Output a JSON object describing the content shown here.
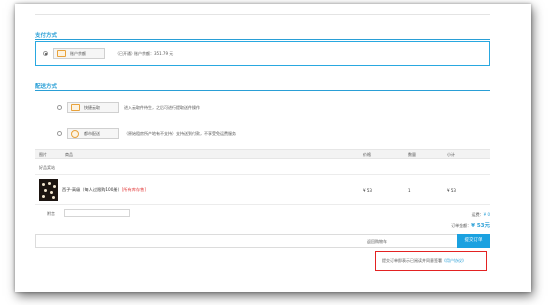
{
  "payment": {
    "title": "支付方式",
    "option_label": "账户余额",
    "status_text": "（已开通）",
    "balance_text": "账户余额：351.79 元"
  },
  "delivery": {
    "title": "配送方式",
    "options": [
      {
        "label": "快捷云取",
        "desc": "进入云取件待生，之后可进行提取送件操作"
      },
      {
        "label": "都市配送",
        "desc": "（原始租房所产地有不支持）支持送到付款，不享受免运费服务"
      }
    ]
  },
  "table": {
    "headers": [
      "图片",
      "商品",
      "价格",
      "数量",
      "小计"
    ],
    "group_label": "好品奖站",
    "row": {
      "name": "西子-高级（每人过限购100册）",
      "tag": "[所有库存售]",
      "price": "¥ 53",
      "qty": "1",
      "subtotal": "¥ 53"
    }
  },
  "note": {
    "label": "附言"
  },
  "summary": {
    "shipping_label": "运费：",
    "shipping_value": "¥ 0",
    "total_label": "订单金额：",
    "total_value": "¥ 53元"
  },
  "submit": {
    "back_label": "返回购物车",
    "button_label": "提交订单"
  },
  "agreement": {
    "text": "提交订单即表示已阅读并同意签署",
    "link": "《用户协议》"
  },
  "colors": {
    "accent": "#2a9fd6",
    "button": "#1aa1e0",
    "highlight_border": "#e32222",
    "tag_red": "#e23b3b"
  }
}
